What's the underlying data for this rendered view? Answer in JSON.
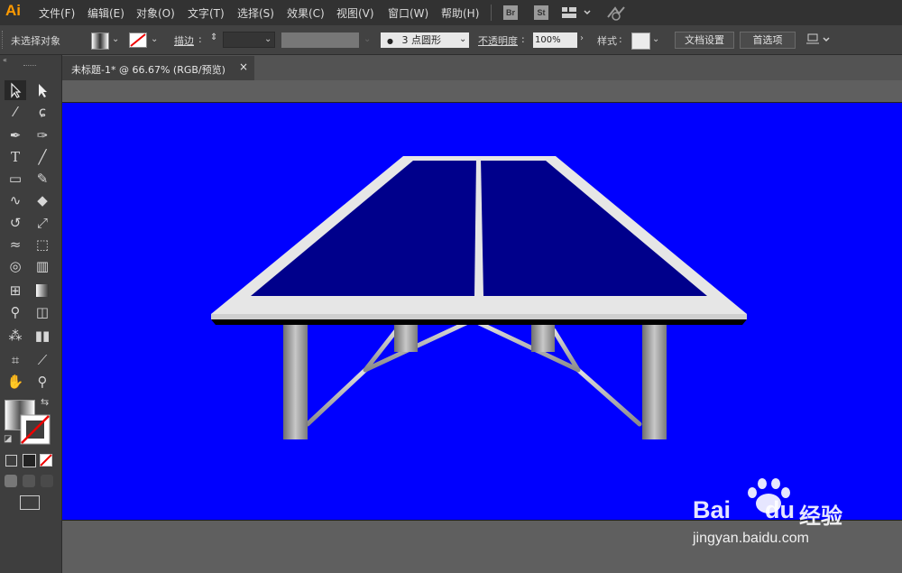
{
  "app": {
    "logo": "Ai"
  },
  "menu": [
    "文件(F)",
    "编辑(E)",
    "对象(O)",
    "文字(T)",
    "选择(S)",
    "效果(C)",
    "视图(V)",
    "窗口(W)",
    "帮助(H)"
  ],
  "app_switch": {
    "bridge": "Br",
    "stock": "St"
  },
  "control": {
    "selection_status": "未选择对象",
    "stroke_label": "描边",
    "brush_value": "3 点圆形",
    "opacity_label": "不透明度",
    "opacity_value": "100%",
    "style_label": "样式",
    "doc_setup": "文档设置",
    "preferences": "首选项"
  },
  "document": {
    "tab_title": "未标题-1* @ 66.67% (RGB/预览)",
    "close": "×"
  },
  "artboard": {
    "background": "#0000ff",
    "table_top": "#00008b",
    "table_border": "#e6e6e6"
  },
  "watermark": {
    "brand_left": "Bai",
    "brand_right": "du",
    "product": "经验",
    "url": "jingyan.baidu.com"
  }
}
